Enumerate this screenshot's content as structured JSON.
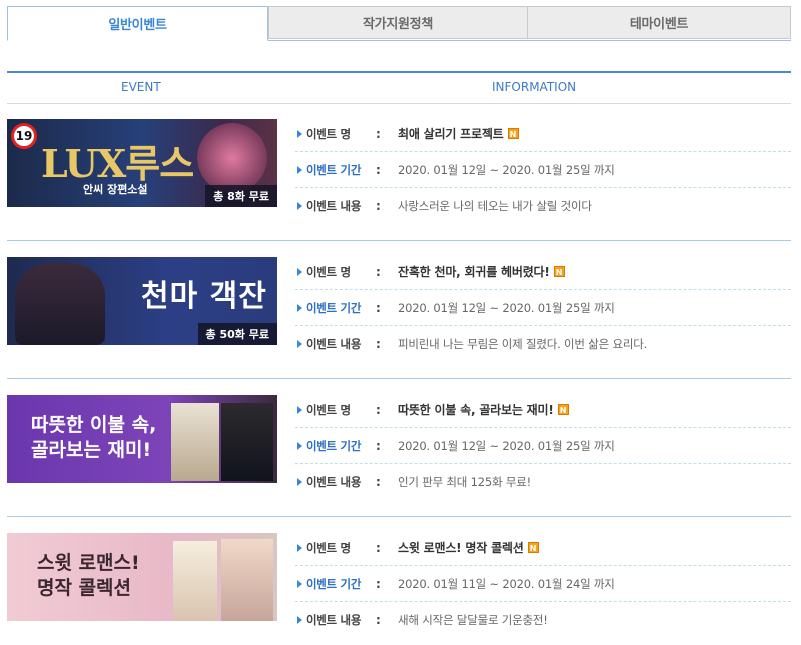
{
  "tabs": [
    {
      "label": "일반이벤트",
      "active": true
    },
    {
      "label": "작가지원정책",
      "active": false
    },
    {
      "label": "테마이벤트",
      "active": false
    }
  ],
  "columns": {
    "event": "EVENT",
    "information": "INFORMATION"
  },
  "labels": {
    "name": "이벤트 명",
    "period": "이벤트 기간",
    "content": "이벤트 내용",
    "colon": ":"
  },
  "new_badge": "N",
  "events": [
    {
      "title": "최애 살리기 프로젝트",
      "period": "2020. 01월 12일 ~ 2020. 01월 25일 까지",
      "content": "사랑스러운 나의 테오는 내가 살릴 것이다",
      "banner": {
        "age": "19",
        "main": "LUX루스",
        "sub": "안씨 장편소설",
        "footer": "총 8화 무료"
      }
    },
    {
      "title": "잔혹한 천마, 회귀를 헤버렸다!",
      "period": "2020. 01월 12일 ~ 2020. 01월 25일 까지",
      "content": "피비린내 나는 무림은 이제 질렸다. 이번 삶은 요리다.",
      "banner": {
        "main": "천마 객잔",
        "footer": "총 50화 무료"
      }
    },
    {
      "title": "따뜻한 이불 속, 골라보는 재미!",
      "period": "2020. 01월 12일 ~ 2020. 01월 25일 까지",
      "content": "인기 판무 최대 125화 무료!",
      "banner": {
        "line1": "따뜻한 이불 속,",
        "line2": "골라보는 재미!"
      }
    },
    {
      "title": "스윗 로맨스! 명작 콜렉션",
      "period": "2020. 01월 11일 ~ 2020. 01월 24일 까지",
      "content": "새해 시작은 달달물로 기운충전!",
      "banner": {
        "line1": "스윗 로맨스!",
        "line2": "명작 콜렉션"
      }
    }
  ],
  "colors": {
    "accent": "#3a86d6",
    "label_blue": "#2e6fc4",
    "divider": "#a8cde3",
    "badge": "#f7a21b"
  }
}
